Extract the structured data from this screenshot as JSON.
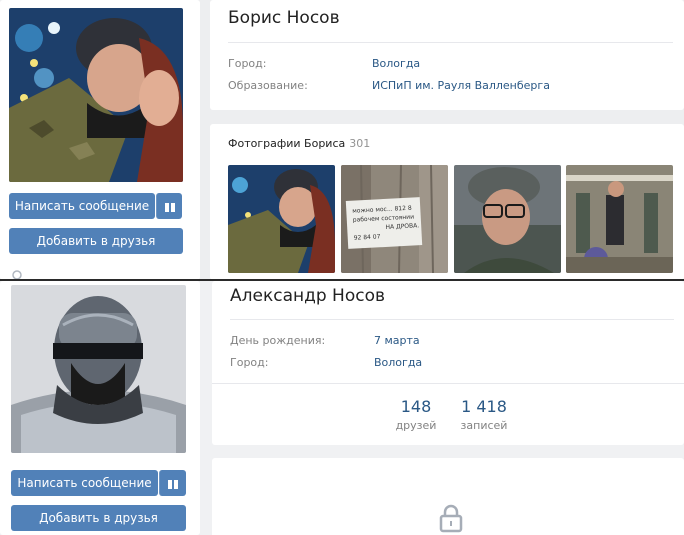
{
  "profile_boris": {
    "name": "Борис Носов",
    "info": [
      {
        "label": "Город:",
        "value": "Вологда"
      },
      {
        "label": "Образование:",
        "value": "ИСПиП им. Рауля Валленберга"
      }
    ],
    "photos": {
      "title": "Фотографии Бориса",
      "count": "301"
    },
    "note_text": [
      "можно мос...",
      "рабочем состоянии",
      "НА ДРОВА.",
      "92 84 07",
      "812 8"
    ],
    "actions": {
      "message": "Написать сообщение",
      "add_friend": "Добавить в друзья"
    }
  },
  "profile_alexander": {
    "name": "Александр Носов",
    "info": [
      {
        "label": "День рождения:",
        "value": "7 марта"
      },
      {
        "label": "Город:",
        "value": "Вологда"
      }
    ],
    "counters": [
      {
        "value": "148",
        "label": "друзей"
      },
      {
        "value": "1 418",
        "label": "записей"
      }
    ],
    "actions": {
      "message": "Написать сообщение",
      "add_friend": "Добавить в друзья"
    }
  },
  "colors": {
    "accent": "#5181b8",
    "link": "#2a5885",
    "label": "#828282"
  },
  "icons": [
    "gift-icon",
    "lock-icon",
    "person-icon"
  ]
}
